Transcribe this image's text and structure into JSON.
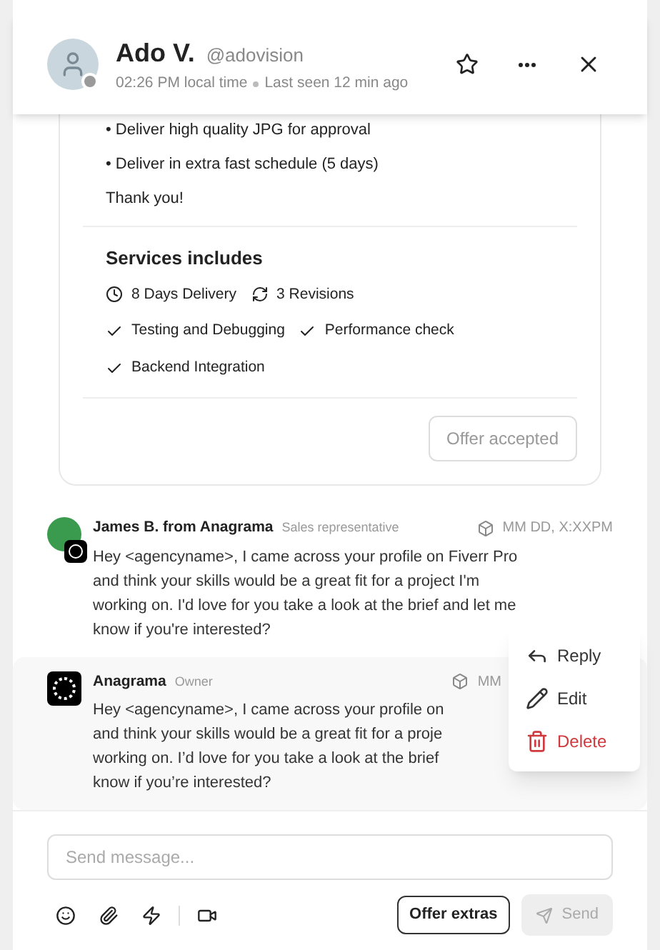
{
  "header": {
    "name": "Ado V.",
    "handle": "@adovision",
    "local_time": "02:26 PM local time",
    "last_seen": "Last seen 12 min ago",
    "online": false
  },
  "offer": {
    "lines": [
      "• Deliver high quality JPG for approval",
      "• Deliver in extra fast schedule (5 days)",
      "Thank you!"
    ],
    "services_title": "Services includes",
    "services": [
      {
        "kind": "clock",
        "label": "8 Days Delivery"
      },
      {
        "kind": "revisions",
        "label": "3 Revisions"
      },
      {
        "kind": "check",
        "label": "Testing and Debugging"
      },
      {
        "kind": "check",
        "label": "Performance check"
      },
      {
        "kind": "check",
        "label": "Backend Integration"
      }
    ],
    "status_button": "Offer accepted"
  },
  "messages": [
    {
      "sender": "James B. from Anagrama",
      "role": "Sales representative",
      "time": "MM DD, X:XXPM",
      "highlighted": false,
      "kind": "person",
      "lines": [
        "Hey <agencyname>, I came across your profile on Fiverr Pro",
        "and think your skills would be a great fit for a project I'm",
        "working on. I'd love for you take a look at the brief and let me",
        "know if you're interested?"
      ]
    },
    {
      "sender": "Anagrama",
      "role": "Owner",
      "time": "MM",
      "highlighted": true,
      "kind": "logo",
      "lines": [
        "Hey <agencyname>, I came across your profile on",
        "and think your skills would be a great fit for a proje",
        "working on. I’d love for you take a look at the brief",
        "know if you’re interested?"
      ]
    }
  ],
  "context_menu": [
    {
      "kind": "reply",
      "label": "Reply"
    },
    {
      "kind": "edit",
      "label": "Edit"
    },
    {
      "kind": "delete",
      "label": "Delete"
    }
  ],
  "composer": {
    "placeholder": "Send message...",
    "offer_button": "Offer extras",
    "send_button": "Send",
    "send_disabled": true
  }
}
